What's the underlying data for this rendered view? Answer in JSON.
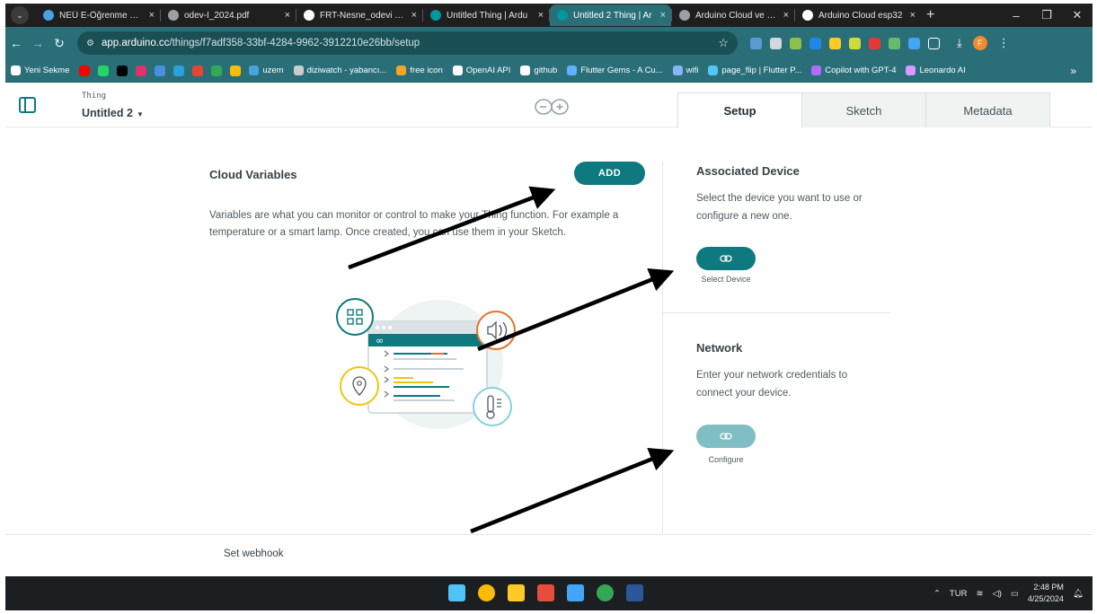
{
  "browser": {
    "tabs": [
      {
        "title": "NEÜ E-Öğrenme Sist",
        "favicon": "moodle-icon",
        "color": "#4aa3df",
        "active": false
      },
      {
        "title": "odev-I_2024.pdf",
        "favicon": "globe-icon",
        "color": "#9aa0a6",
        "active": false
      },
      {
        "title": "FRT-Nesne_odevi - W",
        "favicon": "wordpress-icon",
        "color": "#ffffff",
        "active": false
      },
      {
        "title": "Untitled Thing | Ardu",
        "favicon": "arduino-icon",
        "color": "#00979d",
        "active": false
      },
      {
        "title": "Untitled 2 Thing | Ar",
        "favicon": "arduino-icon",
        "color": "#00979d",
        "active": true
      },
      {
        "title": "Arduino Cloud ve We",
        "favicon": "globe-icon",
        "color": "#9aa0a6",
        "active": false
      },
      {
        "title": "Arduino Cloud esp32",
        "favicon": "wordpress-icon",
        "color": "#ffffff",
        "active": false
      }
    ],
    "close_glyph": "×",
    "new_tab_glyph": "+",
    "url_prefix": "app.arduino.cc",
    "url_path": "/things/f7adf358-33bf-4284-9962-3912210e26bb/setup",
    "profile_initial": "F",
    "bookmarks": [
      {
        "label": "Yeni Sekme",
        "color": "#ffffff"
      },
      {
        "label": "",
        "color": "#ff0000"
      },
      {
        "label": "",
        "color": "#25d366"
      },
      {
        "label": "",
        "color": "#000000"
      },
      {
        "label": "",
        "color": "#e1306c"
      },
      {
        "label": "",
        "color": "#4a90e2"
      },
      {
        "label": "",
        "color": "#2aa1da"
      },
      {
        "label": "",
        "color": "#ea4335"
      },
      {
        "label": "",
        "color": "#34a853"
      },
      {
        "label": "",
        "color": "#fbbc04"
      },
      {
        "label": "uzem",
        "color": "#4aa3df"
      },
      {
        "label": "diziwatch - yabancı...",
        "color": "#cccccc"
      },
      {
        "label": "free icon",
        "color": "#f5a623"
      },
      {
        "label": "OpenAI API",
        "color": "#ffffff"
      },
      {
        "label": "github",
        "color": "#ffffff"
      },
      {
        "label": "Flutter Gems - A Cu...",
        "color": "#5fb2ff"
      },
      {
        "label": "wifi",
        "color": "#8ab4f8"
      },
      {
        "label": "page_flip | Flutter P...",
        "color": "#54c5f8"
      },
      {
        "label": "Copilot with GPT-4",
        "color": "#b36bff"
      },
      {
        "label": "Leonardo AI",
        "color": "#d89bff"
      }
    ],
    "bookmarks_more": "»"
  },
  "app": {
    "thing_kicker": "Thing",
    "thing_name": "Untitled 2",
    "tabs": [
      "Setup",
      "Sketch",
      "Metadata"
    ],
    "active_tab": "Setup",
    "accent_color": "#0e7a80"
  },
  "cloud_variables": {
    "title": "Cloud Variables",
    "add_label": "ADD",
    "description": "Variables are what you can monitor or control to make your Thing function. For example a temperature or a smart lamp. Once created, you can use them in your Sketch."
  },
  "associated_device": {
    "title": "Associated Device",
    "description": "Select the device you want to use or configure a new one.",
    "button_label": "Select Device"
  },
  "network": {
    "title": "Network",
    "description": "Enter your network credentials to connect your device.",
    "button_label": "Configure"
  },
  "footer": {
    "webhook_label": "Set webhook"
  },
  "taskbar": {
    "language": "TUR",
    "time": "2:48 PM",
    "date": "4/25/2024",
    "apps": [
      "windows-start-icon",
      "chrome-icon",
      "file-explorer-icon",
      "microsoft-store-icon",
      "notepad-icon",
      "chrome-alt-icon",
      "word-icon"
    ]
  }
}
